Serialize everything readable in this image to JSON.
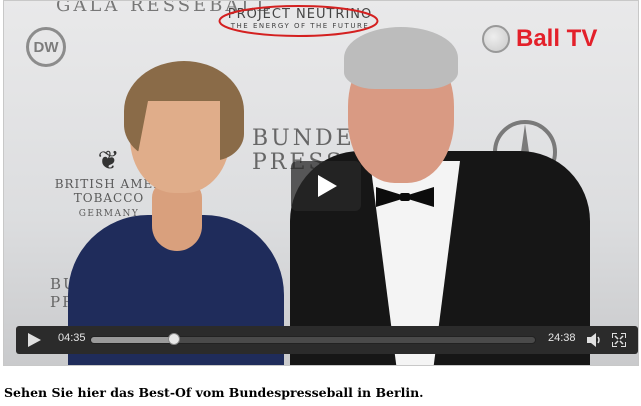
{
  "video": {
    "backdrop": {
      "top_left_partial": "GALA",
      "top_partial": "RESSEBALL",
      "dw_logo": "DW",
      "ball_tv": "Ball TV",
      "project_neutrino": "PROJECT NEUTRINO",
      "project_neutrino_tagline": "THE ENERGY OF THE FUTURE",
      "sponsor_line1": "BRITISH AMER",
      "sponsor_line2": "TOBACCO",
      "sponsor_line3": "GERMANY",
      "bundespresseball_1": "BUNDES",
      "bundespresseball_2": "PRESSEBALL",
      "bundes_small_1": "BUN",
      "bundes_small_2": "PRES",
      "highlight_color": "#d42020"
    },
    "controls": {
      "current_time": "04:35",
      "total_time": "24:38",
      "progress": 0.186
    }
  },
  "caption": "Sehen Sie hier das Best-Of vom Bundespresseball in Berlin."
}
